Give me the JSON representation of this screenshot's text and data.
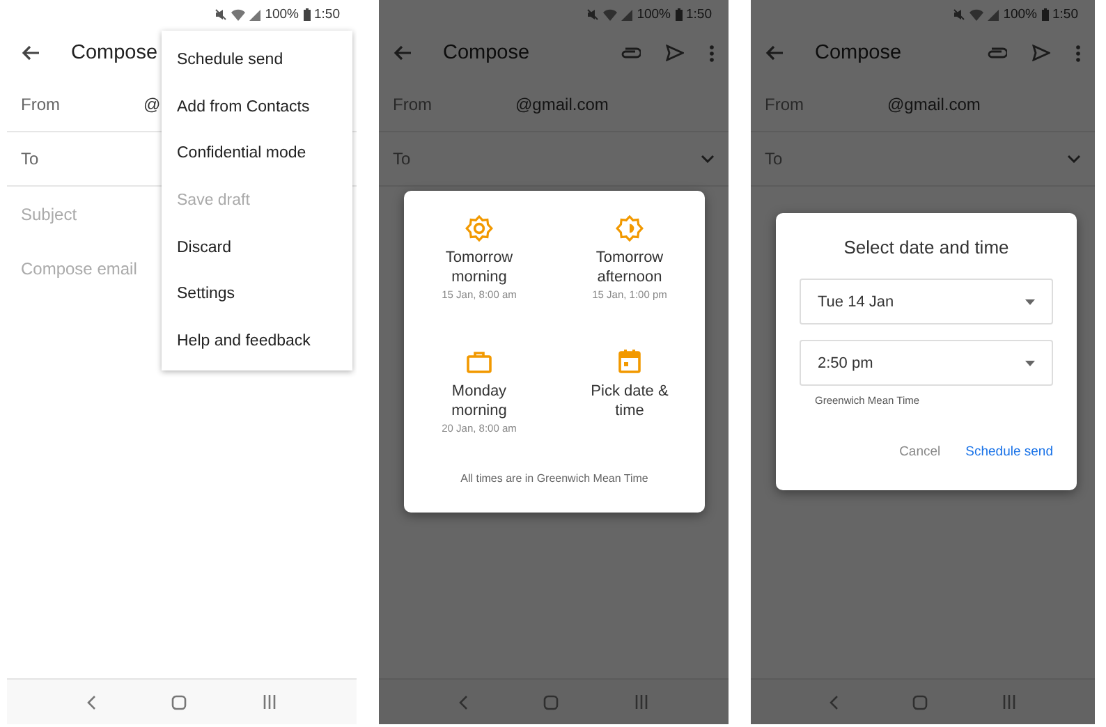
{
  "panels": [
    {
      "status_bar": {
        "battery": "100%",
        "time": "1:50"
      },
      "app_bar": {
        "title": "Compose"
      },
      "fields": [
        {
          "kind": "row",
          "label": "From",
          "value": "@"
        },
        {
          "kind": "row",
          "label": "To"
        },
        {
          "kind": "hint",
          "placeholder": "Subject"
        },
        {
          "kind": "hint",
          "placeholder": "Compose email"
        }
      ],
      "overlay": {
        "kind": "menu",
        "items": [
          {
            "label": "Schedule send",
            "disabled": false
          },
          {
            "label": "Add from Contacts",
            "disabled": false
          },
          {
            "label": "Confidential mode",
            "disabled": false
          },
          {
            "label": "Save draft",
            "disabled": true
          },
          {
            "label": "Discard",
            "disabled": false
          },
          {
            "label": "Settings",
            "disabled": false
          },
          {
            "label": "Help and feedback",
            "disabled": false
          }
        ]
      }
    },
    {
      "status_bar": {
        "battery": "100%",
        "time": "1:50"
      },
      "app_bar": {
        "title": "Compose"
      },
      "fields": [
        {
          "kind": "row",
          "label": "From",
          "value": "@gmail.com"
        },
        {
          "kind": "dropdown",
          "label": "To"
        }
      ],
      "overlay": {
        "kind": "options",
        "options": [
          {
            "title": "Tomorrow morning",
            "detail": "15 Jan, 8:00 am"
          },
          {
            "title": "Tomorrow afternoon",
            "detail": "15 Jan, 1:00 pm"
          },
          {
            "title": "Monday morning",
            "detail": "20 Jan, 8:00 am"
          },
          {
            "title": "Pick date & time"
          }
        ],
        "footer": "All times are in Greenwich Mean Time"
      }
    },
    {
      "status_bar": {
        "battery": "100%",
        "time": "1:50"
      },
      "app_bar": {
        "title": "Compose"
      },
      "fields": [
        {
          "kind": "row",
          "label": "From",
          "value": "@gmail.com"
        },
        {
          "kind": "dropdown",
          "label": "To"
        }
      ],
      "overlay": {
        "kind": "picker",
        "title": "Select date and time",
        "dropdowns": [
          {
            "value": "Tue 14 Jan"
          },
          {
            "value": "2:50 pm"
          }
        ],
        "caption": "Greenwich Mean Time",
        "buttons": [
          {
            "label": "Cancel",
            "primary": false
          },
          {
            "label": "Schedule send",
            "primary": true
          }
        ]
      }
    }
  ]
}
